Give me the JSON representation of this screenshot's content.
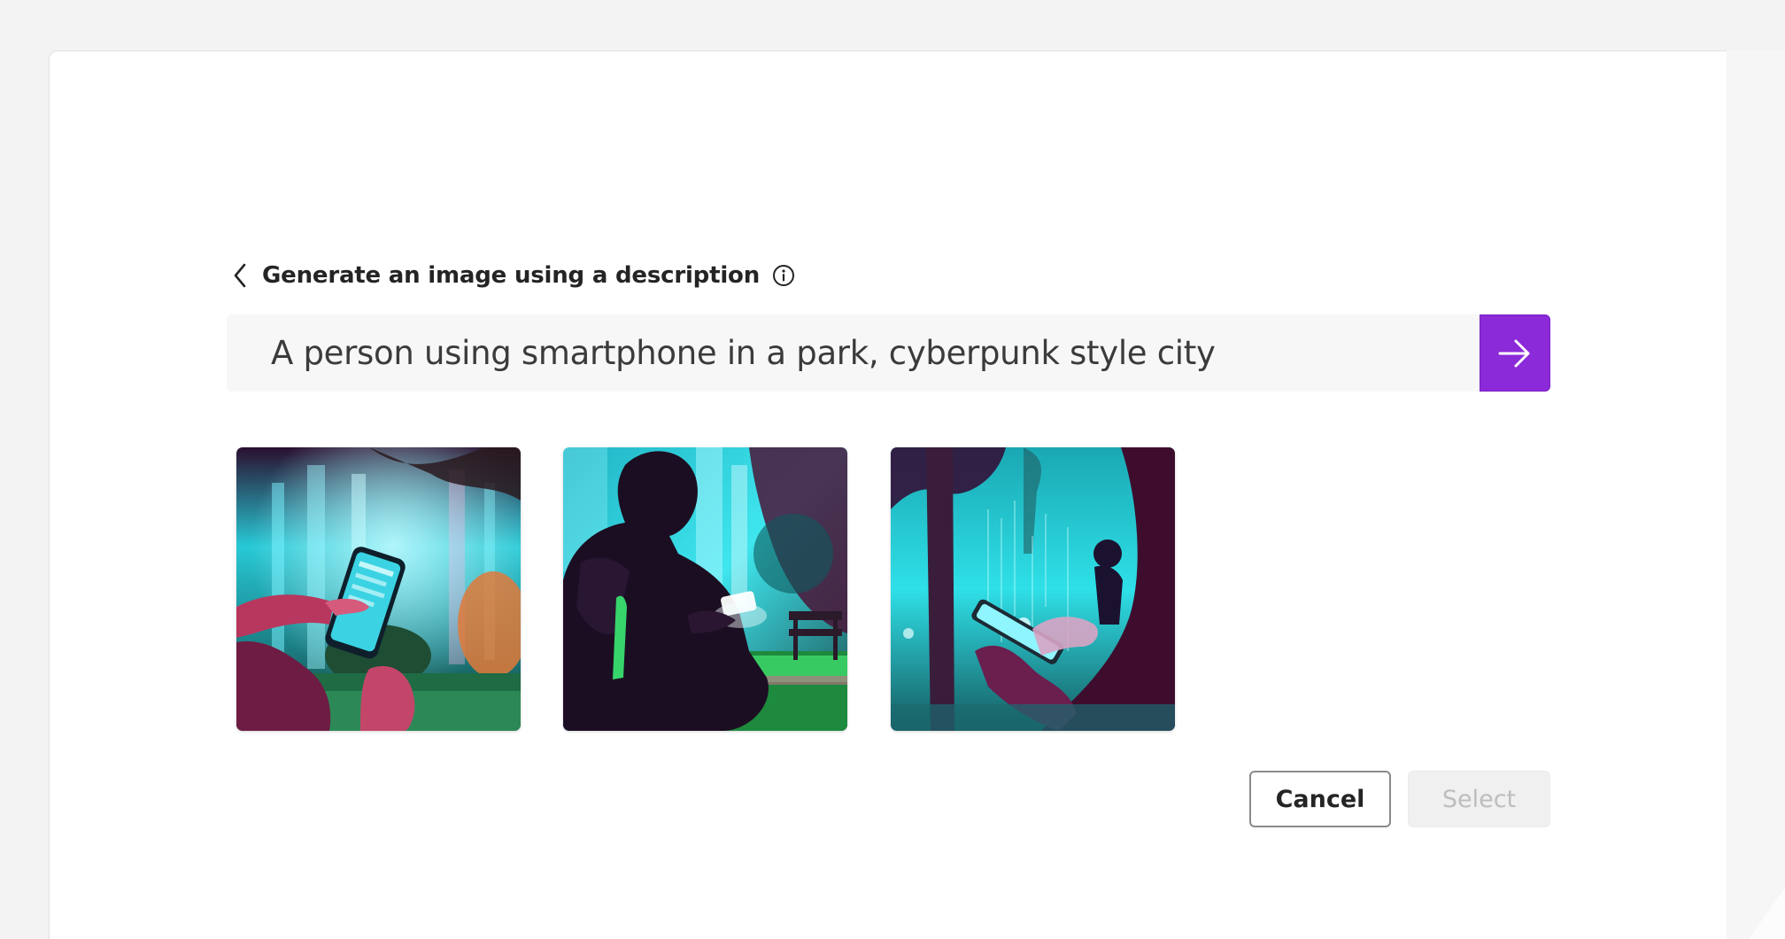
{
  "dialog": {
    "heading": "Generate an image using a description",
    "back_icon": "chevron-left-icon",
    "info_icon": "info-icon"
  },
  "prompt": {
    "value": "A person using smartphone in a park, cyberpunk style city",
    "submit_icon": "arrow-right-icon",
    "accent_color": "#8b2ad9"
  },
  "results": [
    {
      "id": "generated-image-1"
    },
    {
      "id": "generated-image-2"
    },
    {
      "id": "generated-image-3"
    }
  ],
  "actions": {
    "cancel_label": "Cancel",
    "select_label": "Select"
  }
}
